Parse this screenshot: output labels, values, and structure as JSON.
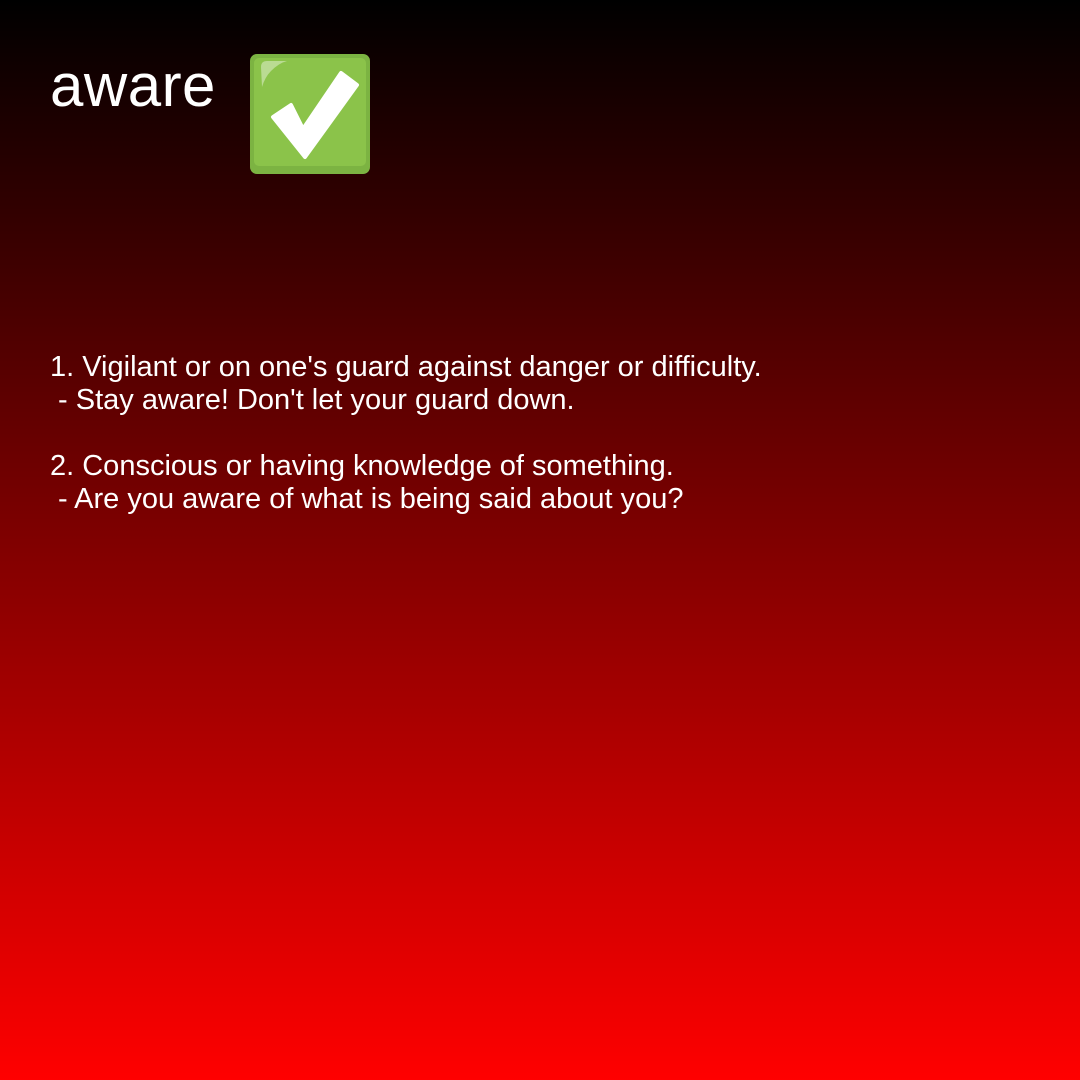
{
  "word": "aware",
  "icon": {
    "name": "check-mark-button-icon",
    "color": "#7cb342"
  },
  "definitions": [
    {
      "definition": "1. Vigilant or on one's guard against danger or difficulty.",
      "example": " - Stay aware! Don't let your guard down."
    },
    {
      "definition": "2. Conscious or having knowledge of something.",
      "example": " - Are you aware of what is being said about you?"
    }
  ],
  "colors": {
    "gradient_top": "#000000",
    "gradient_bottom": "#ff0000",
    "text": "#ffffff"
  }
}
